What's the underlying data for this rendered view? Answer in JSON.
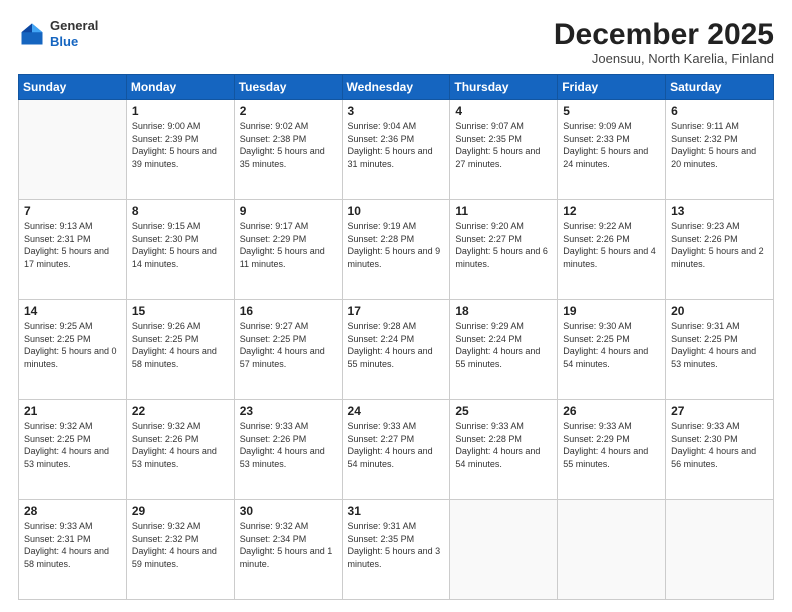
{
  "header": {
    "logo_line1": "General",
    "logo_line2": "Blue",
    "month": "December 2025",
    "location": "Joensuu, North Karelia, Finland"
  },
  "weekdays": [
    "Sunday",
    "Monday",
    "Tuesday",
    "Wednesday",
    "Thursday",
    "Friday",
    "Saturday"
  ],
  "weeks": [
    [
      {
        "day": "",
        "sunrise": "",
        "sunset": "",
        "daylight": ""
      },
      {
        "day": "1",
        "sunrise": "Sunrise: 9:00 AM",
        "sunset": "Sunset: 2:39 PM",
        "daylight": "Daylight: 5 hours and 39 minutes."
      },
      {
        "day": "2",
        "sunrise": "Sunrise: 9:02 AM",
        "sunset": "Sunset: 2:38 PM",
        "daylight": "Daylight: 5 hours and 35 minutes."
      },
      {
        "day": "3",
        "sunrise": "Sunrise: 9:04 AM",
        "sunset": "Sunset: 2:36 PM",
        "daylight": "Daylight: 5 hours and 31 minutes."
      },
      {
        "day": "4",
        "sunrise": "Sunrise: 9:07 AM",
        "sunset": "Sunset: 2:35 PM",
        "daylight": "Daylight: 5 hours and 27 minutes."
      },
      {
        "day": "5",
        "sunrise": "Sunrise: 9:09 AM",
        "sunset": "Sunset: 2:33 PM",
        "daylight": "Daylight: 5 hours and 24 minutes."
      },
      {
        "day": "6",
        "sunrise": "Sunrise: 9:11 AM",
        "sunset": "Sunset: 2:32 PM",
        "daylight": "Daylight: 5 hours and 20 minutes."
      }
    ],
    [
      {
        "day": "7",
        "sunrise": "Sunrise: 9:13 AM",
        "sunset": "Sunset: 2:31 PM",
        "daylight": "Daylight: 5 hours and 17 minutes."
      },
      {
        "day": "8",
        "sunrise": "Sunrise: 9:15 AM",
        "sunset": "Sunset: 2:30 PM",
        "daylight": "Daylight: 5 hours and 14 minutes."
      },
      {
        "day": "9",
        "sunrise": "Sunrise: 9:17 AM",
        "sunset": "Sunset: 2:29 PM",
        "daylight": "Daylight: 5 hours and 11 minutes."
      },
      {
        "day": "10",
        "sunrise": "Sunrise: 9:19 AM",
        "sunset": "Sunset: 2:28 PM",
        "daylight": "Daylight: 5 hours and 9 minutes."
      },
      {
        "day": "11",
        "sunrise": "Sunrise: 9:20 AM",
        "sunset": "Sunset: 2:27 PM",
        "daylight": "Daylight: 5 hours and 6 minutes."
      },
      {
        "day": "12",
        "sunrise": "Sunrise: 9:22 AM",
        "sunset": "Sunset: 2:26 PM",
        "daylight": "Daylight: 5 hours and 4 minutes."
      },
      {
        "day": "13",
        "sunrise": "Sunrise: 9:23 AM",
        "sunset": "Sunset: 2:26 PM",
        "daylight": "Daylight: 5 hours and 2 minutes."
      }
    ],
    [
      {
        "day": "14",
        "sunrise": "Sunrise: 9:25 AM",
        "sunset": "Sunset: 2:25 PM",
        "daylight": "Daylight: 5 hours and 0 minutes."
      },
      {
        "day": "15",
        "sunrise": "Sunrise: 9:26 AM",
        "sunset": "Sunset: 2:25 PM",
        "daylight": "Daylight: 4 hours and 58 minutes."
      },
      {
        "day": "16",
        "sunrise": "Sunrise: 9:27 AM",
        "sunset": "Sunset: 2:25 PM",
        "daylight": "Daylight: 4 hours and 57 minutes."
      },
      {
        "day": "17",
        "sunrise": "Sunrise: 9:28 AM",
        "sunset": "Sunset: 2:24 PM",
        "daylight": "Daylight: 4 hours and 55 minutes."
      },
      {
        "day": "18",
        "sunrise": "Sunrise: 9:29 AM",
        "sunset": "Sunset: 2:24 PM",
        "daylight": "Daylight: 4 hours and 55 minutes."
      },
      {
        "day": "19",
        "sunrise": "Sunrise: 9:30 AM",
        "sunset": "Sunset: 2:25 PM",
        "daylight": "Daylight: 4 hours and 54 minutes."
      },
      {
        "day": "20",
        "sunrise": "Sunrise: 9:31 AM",
        "sunset": "Sunset: 2:25 PM",
        "daylight": "Daylight: 4 hours and 53 minutes."
      }
    ],
    [
      {
        "day": "21",
        "sunrise": "Sunrise: 9:32 AM",
        "sunset": "Sunset: 2:25 PM",
        "daylight": "Daylight: 4 hours and 53 minutes."
      },
      {
        "day": "22",
        "sunrise": "Sunrise: 9:32 AM",
        "sunset": "Sunset: 2:26 PM",
        "daylight": "Daylight: 4 hours and 53 minutes."
      },
      {
        "day": "23",
        "sunrise": "Sunrise: 9:33 AM",
        "sunset": "Sunset: 2:26 PM",
        "daylight": "Daylight: 4 hours and 53 minutes."
      },
      {
        "day": "24",
        "sunrise": "Sunrise: 9:33 AM",
        "sunset": "Sunset: 2:27 PM",
        "daylight": "Daylight: 4 hours and 54 minutes."
      },
      {
        "day": "25",
        "sunrise": "Sunrise: 9:33 AM",
        "sunset": "Sunset: 2:28 PM",
        "daylight": "Daylight: 4 hours and 54 minutes."
      },
      {
        "day": "26",
        "sunrise": "Sunrise: 9:33 AM",
        "sunset": "Sunset: 2:29 PM",
        "daylight": "Daylight: 4 hours and 55 minutes."
      },
      {
        "day": "27",
        "sunrise": "Sunrise: 9:33 AM",
        "sunset": "Sunset: 2:30 PM",
        "daylight": "Daylight: 4 hours and 56 minutes."
      }
    ],
    [
      {
        "day": "28",
        "sunrise": "Sunrise: 9:33 AM",
        "sunset": "Sunset: 2:31 PM",
        "daylight": "Daylight: 4 hours and 58 minutes."
      },
      {
        "day": "29",
        "sunrise": "Sunrise: 9:32 AM",
        "sunset": "Sunset: 2:32 PM",
        "daylight": "Daylight: 4 hours and 59 minutes."
      },
      {
        "day": "30",
        "sunrise": "Sunrise: 9:32 AM",
        "sunset": "Sunset: 2:34 PM",
        "daylight": "Daylight: 5 hours and 1 minute."
      },
      {
        "day": "31",
        "sunrise": "Sunrise: 9:31 AM",
        "sunset": "Sunset: 2:35 PM",
        "daylight": "Daylight: 5 hours and 3 minutes."
      },
      {
        "day": "",
        "sunrise": "",
        "sunset": "",
        "daylight": ""
      },
      {
        "day": "",
        "sunrise": "",
        "sunset": "",
        "daylight": ""
      },
      {
        "day": "",
        "sunrise": "",
        "sunset": "",
        "daylight": ""
      }
    ]
  ]
}
